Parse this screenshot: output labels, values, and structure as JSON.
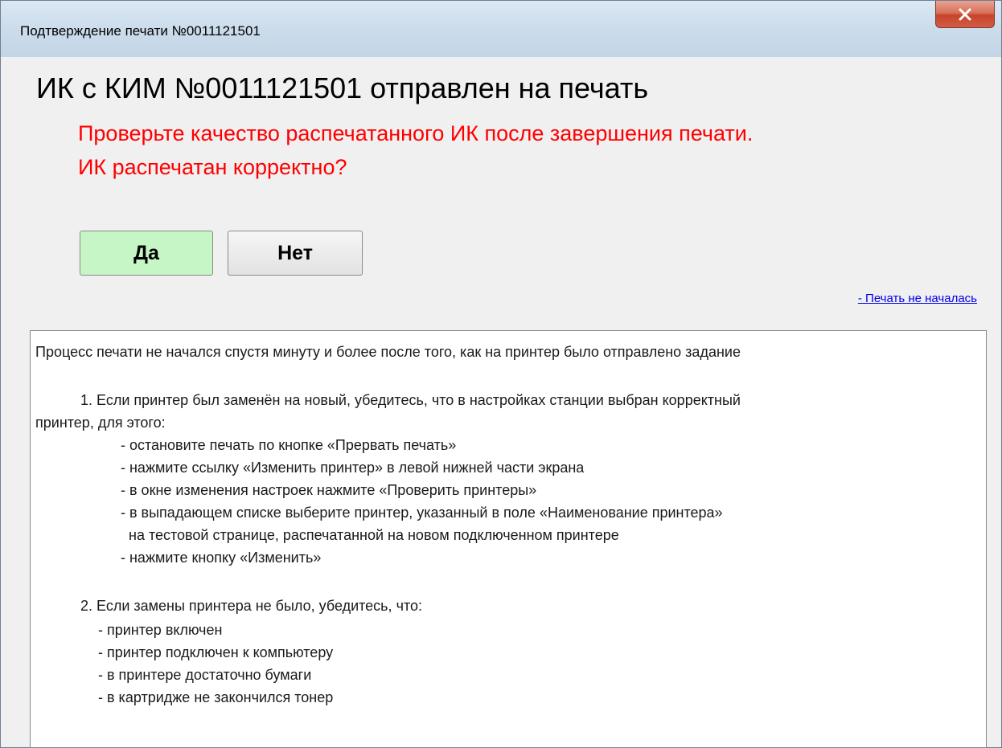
{
  "window": {
    "title": "Подтверждение печати  №0011121501"
  },
  "main": {
    "heading": "ИК с КИМ №0011121501 отправлен на печать",
    "warning_lines": [
      "Проверьте качество распечатанного ИК после завершения печати.",
      "ИК распечатан корректно?"
    ],
    "yes_label": "Да",
    "no_label": "Нет",
    "link_label": "- Печать не началась"
  },
  "info": {
    "lines": [
      "Процесс печати не начался спустя минуту и более после того, как на принтер было отправлено задание",
      "1. Если принтер был заменён на новый, убедитесь, что в настройках станции выбран корректный",
      "принтер, для этого:",
      "- остановите печать по кнопке «Прервать печать»",
      "- нажмите ссылку «Изменить принтер» в левой нижней части экрана",
      "- в окне изменения настроек нажмите «Проверить принтеры»",
      "- в выпадающем списке выберите принтер, указанный в поле «Наименование принтера»",
      "на тестовой странице, распечатанной на новом подключенном принтере",
      "- нажмите кнопку «Изменить»",
      "2. Если замены принтера не было, убедитесь, что:",
      "- принтер включен",
      "- принтер подключен к компьютеру",
      "- в принтере достаточно бумаги",
      "- в картридже не закончился тонер"
    ]
  },
  "colors": {
    "warning": "#ff0000",
    "yes_button": "#c6f5c6",
    "link": "#0000ee"
  },
  "icons": {
    "close": "close-icon"
  }
}
